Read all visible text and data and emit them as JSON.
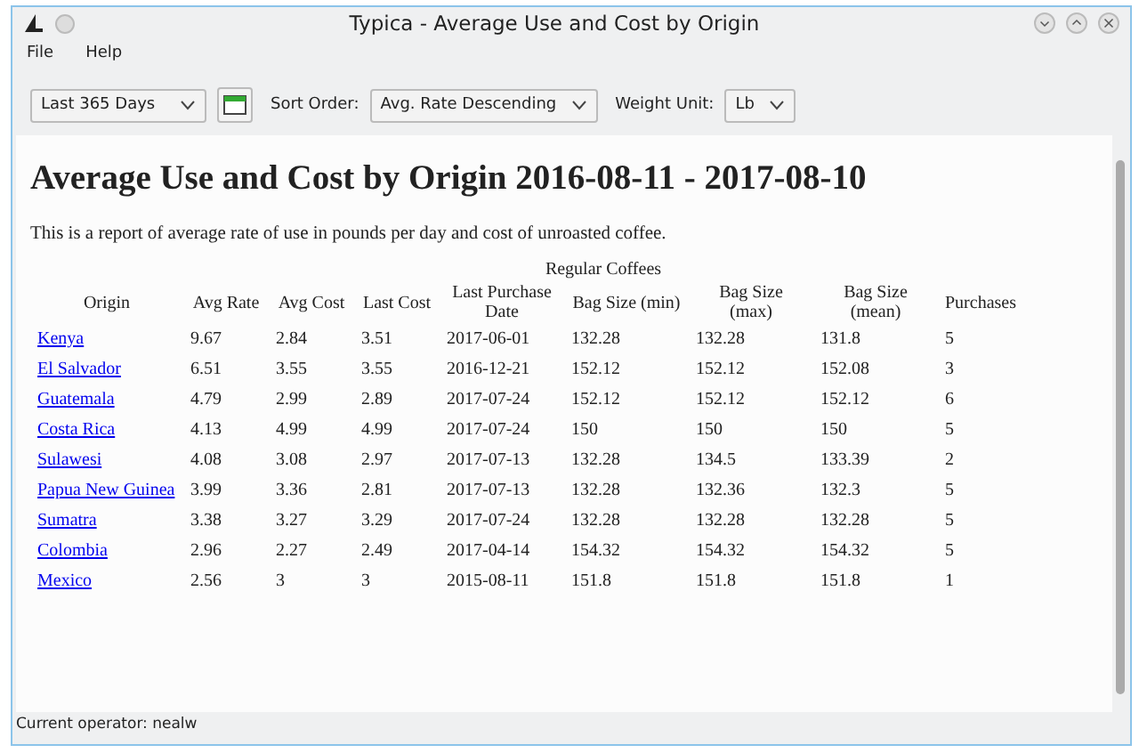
{
  "window": {
    "title": "Typica - Average Use and Cost by Origin"
  },
  "menu": [
    "File",
    "Help"
  ],
  "toolbar": {
    "range": "Last 365 Days",
    "sort_label": "Sort Order:",
    "sort": "Avg. Rate Descending",
    "unit_label": "Weight Unit:",
    "unit": "Lb"
  },
  "report": {
    "title": "Average Use and Cost by Origin 2016-08-11 - 2017-08-10",
    "description": "This is a report of average rate of use in pounds per day and cost of unroasted coffee.",
    "table": {
      "group": "Regular Coffees",
      "columns": [
        "Origin",
        "Avg Rate",
        "Avg Cost",
        "Last Cost",
        "Last Purchase Date",
        "Bag Size (min)",
        "Bag Size (max)",
        "Bag Size (mean)",
        "Purchases"
      ],
      "rows": [
        [
          "Kenya",
          "9.67",
          "2.84",
          "3.51",
          "2017-06-01",
          "132.28",
          "132.28",
          "131.8",
          "5"
        ],
        [
          "El Salvador",
          "6.51",
          "3.55",
          "3.55",
          "2016-12-21",
          "152.12",
          "152.12",
          "152.08",
          "3"
        ],
        [
          "Guatemala",
          "4.79",
          "2.99",
          "2.89",
          "2017-07-24",
          "152.12",
          "152.12",
          "152.12",
          "6"
        ],
        [
          "Costa Rica",
          "4.13",
          "4.99",
          "4.99",
          "2017-07-24",
          "150",
          "150",
          "150",
          "5"
        ],
        [
          "Sulawesi",
          "4.08",
          "3.08",
          "2.97",
          "2017-07-13",
          "132.28",
          "134.5",
          "133.39",
          "2"
        ],
        [
          "Papua New Guinea",
          "3.99",
          "3.36",
          "2.81",
          "2017-07-13",
          "132.28",
          "132.36",
          "132.3",
          "5"
        ],
        [
          "Sumatra",
          "3.38",
          "3.27",
          "3.29",
          "2017-07-24",
          "132.28",
          "132.28",
          "132.28",
          "5"
        ],
        [
          "Colombia",
          "2.96",
          "2.27",
          "2.49",
          "2017-04-14",
          "154.32",
          "154.32",
          "154.32",
          "5"
        ],
        [
          "Mexico",
          "2.56",
          "3",
          "3",
          "2015-08-11",
          "151.8",
          "151.8",
          "151.8",
          "1"
        ]
      ]
    }
  },
  "status_bar": "Current operator: nealw"
}
